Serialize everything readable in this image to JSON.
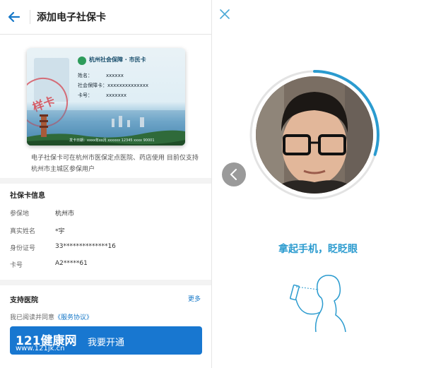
{
  "header": {
    "title": "添加电子社保卡"
  },
  "card": {
    "org": "杭州社会保障 · 市民卡",
    "fields": [
      {
        "label": "姓名：",
        "value": "xxxxxx"
      },
      {
        "label": "社会保障卡：",
        "value": "xxxxxxxxxxxxxx"
      },
      {
        "label": "卡号：",
        "value": "xxxxxxx"
      }
    ],
    "stamp": "样卡",
    "footer": "发卡日期：xxxx年xx月  xxxxxx  12345  xxxx  90001"
  },
  "notice": "电子社保卡可在杭州市医保定点医院、药店使用 目前仅支持杭州市主城区参保用户",
  "info": {
    "title": "社保卡信息",
    "rows": [
      {
        "key": "参保地",
        "value": "杭州市"
      },
      {
        "key": "真实姓名",
        "value": "*宇"
      },
      {
        "key": "身份证号",
        "value": "33**************16"
      },
      {
        "key": "卡号",
        "value": "A2*****61"
      }
    ]
  },
  "hospitals": {
    "title": "支持医院",
    "more": "更多"
  },
  "agreement": {
    "prefix": "我已阅读并同意",
    "link": "《服务协议》"
  },
  "open_button": "我要开通",
  "watermark": {
    "brand": "121健康网",
    "url": "www.121jk.cn"
  },
  "face_scan": {
    "instruction": "拿起手机，眨眨眼",
    "progress": 0.3
  },
  "colors": {
    "accent": "#1877d0",
    "scan_blue": "#2b9bcf"
  }
}
